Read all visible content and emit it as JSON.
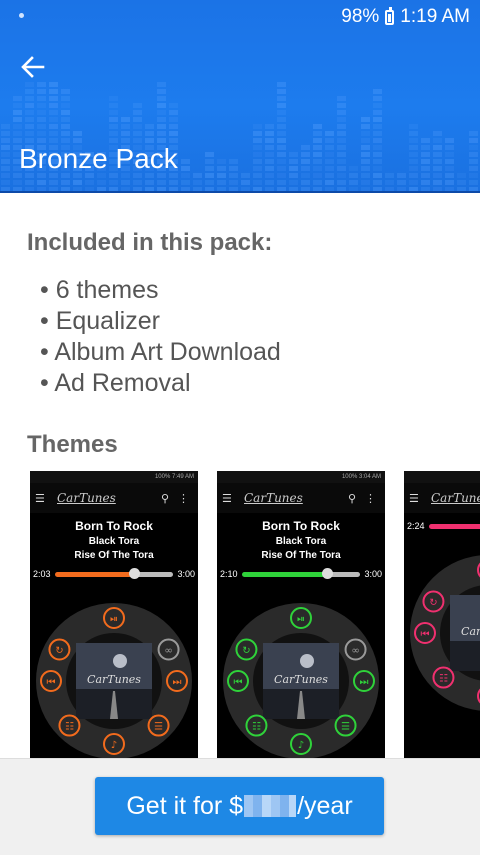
{
  "status_bar": {
    "battery": "98%",
    "time": "1:19 AM"
  },
  "header": {
    "title": "Bronze Pack"
  },
  "included": {
    "heading": "Included in this pack:",
    "items": [
      "6 themes",
      "Equalizer",
      "Album Art Download",
      "Ad Removal"
    ]
  },
  "themes": {
    "heading": "Themes",
    "screenshots": [
      {
        "status": "100% 7:49 AM",
        "app_name": "CarTunes",
        "song": "Born To Rock",
        "artist": "Black Tora",
        "album": "Rise Of The Tora",
        "elapsed": "2:03",
        "duration": "3:00",
        "progress": 0.67,
        "accent": "#f26b1d"
      },
      {
        "status": "100% 3:04 AM",
        "app_name": "CarTunes",
        "song": "Born To Rock",
        "artist": "Black Tora",
        "album": "Rise Of The Tora",
        "elapsed": "2:10",
        "duration": "3:00",
        "progress": 0.72,
        "accent": "#2fd23a"
      },
      {
        "status": "",
        "app_name": "CarTunes",
        "song": "",
        "artist": "",
        "album": "",
        "elapsed": "2:24",
        "duration": "",
        "progress": 0.8,
        "accent": "#f0306f"
      }
    ]
  },
  "footer": {
    "button_prefix": "Get it for $",
    "button_suffix": "/year"
  },
  "colors": {
    "header_blue": "#1b73e6",
    "button_blue": "#1e88e5"
  }
}
